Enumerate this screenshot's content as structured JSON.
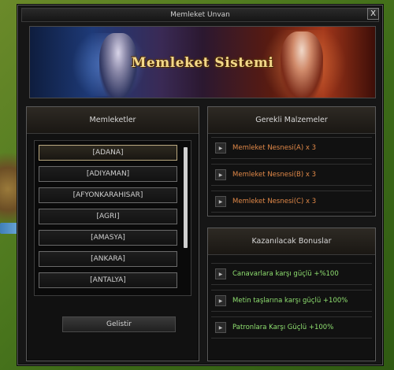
{
  "window": {
    "title": "Memleket Unvan",
    "close_label": "X"
  },
  "banner": {
    "title": "Memleket Sistemi"
  },
  "cities_panel": {
    "header": "Memleketler",
    "items": [
      "[ADANA]",
      "[ADIYAMAN]",
      "[AFYONKARAHISAR]",
      "[AGRI]",
      "[AMASYA]",
      "[ANKARA]",
      "[ANTALYA]"
    ],
    "selected_index": 0,
    "button_label": "Gelistir"
  },
  "required_panel": {
    "header": "Gerekli Malzemeler",
    "items": [
      "Memleket Nesnesi(A) x 3",
      "Memleket Nesnesi(B) x 3",
      "Memleket Nesnesi(C) x 3"
    ]
  },
  "bonus_panel": {
    "header": "Kazanılacak Bonuslar",
    "items": [
      "Canavarlara karşı güçlü +%100",
      "Metin taşlarına karşı güçlü +100%",
      "Patronlara Karşı Güçlü +100%"
    ]
  },
  "icons": {
    "row_arrow": "play-arrow-icon"
  },
  "colors": {
    "required_text": "#e08848",
    "bonus_text": "#8fe070"
  }
}
